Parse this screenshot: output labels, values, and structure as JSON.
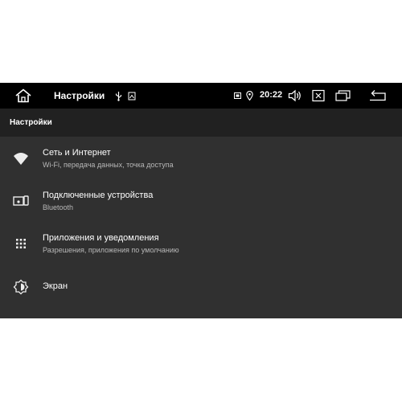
{
  "statusbar": {
    "title": "Настройки",
    "time": "20:22"
  },
  "header": {
    "title": "Настройки"
  },
  "settings": {
    "items": [
      {
        "title": "Сеть и Интернет",
        "subtitle": "Wi-Fi, передача данных, точка доступа",
        "icon": "wifi-icon"
      },
      {
        "title": "Подключенные устройства",
        "subtitle": "Bluetooth",
        "icon": "connected-devices-icon"
      },
      {
        "title": "Приложения и уведомления",
        "subtitle": "Разрешения, приложения по умолчанию",
        "icon": "apps-grid-icon"
      },
      {
        "title": "Экран",
        "subtitle": "",
        "icon": "brightness-icon"
      }
    ]
  },
  "colors": {
    "statusbar_bg": "#000000",
    "header_bg": "#212121",
    "list_bg": "#303030",
    "primary_text": "#ffffff",
    "secondary_text": "#b8b8b8"
  }
}
